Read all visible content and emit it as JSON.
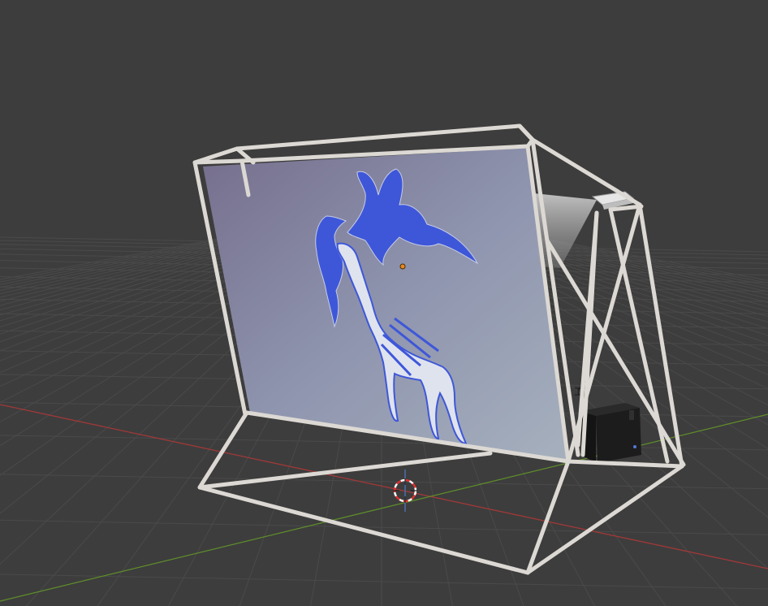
{
  "viewport": {
    "mode": "3D Viewport",
    "background_color": "#3d3d3d",
    "grid_color": "#4a4a4a",
    "x_axis_color": "#b03a3a",
    "y_axis_color": "#6a9a2a"
  },
  "scene": {
    "objects": [
      {
        "name": "frame",
        "kind": "wireframe-stand",
        "color": "#dedad6"
      },
      {
        "name": "screen",
        "kind": "projection-screen",
        "gradient": [
          "#7a7390",
          "#8f98b0",
          "#a8b2bf"
        ]
      },
      {
        "name": "skeleton",
        "kind": "deer-skeleton-image",
        "color": "#3d55d8"
      },
      {
        "name": "projector",
        "kind": "projector-with-light-cone"
      },
      {
        "name": "computer-box",
        "kind": "black-box"
      }
    ],
    "origin_point_color": "#e98a1a",
    "cursor_colors": [
      "#e03030",
      "#ffffff"
    ]
  }
}
